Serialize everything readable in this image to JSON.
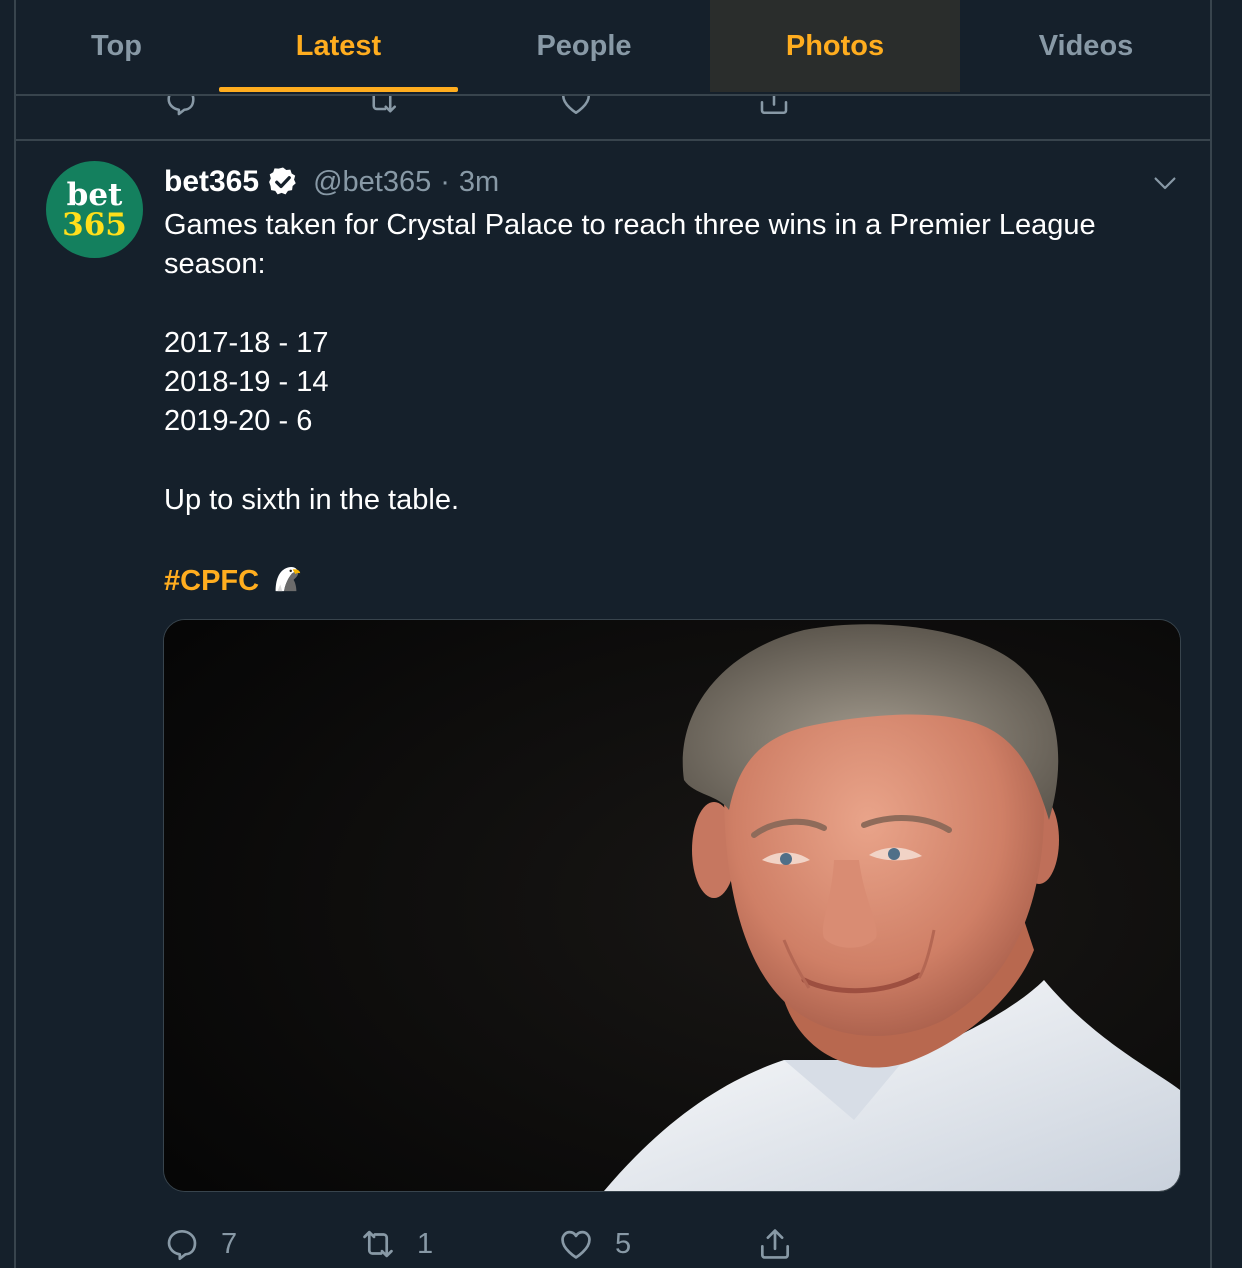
{
  "tabs": [
    {
      "label": "Top"
    },
    {
      "label": "Latest"
    },
    {
      "label": "People"
    },
    {
      "label": "Photos"
    },
    {
      "label": "Videos"
    }
  ],
  "active_tab": "Latest",
  "hovered_tab": "Photos",
  "colors": {
    "background": "#15202b",
    "accent": "#ffad1f",
    "secondary_text": "#8899a6",
    "border": "#38444d",
    "avatar_bg": "#14805e",
    "avatar_yellow": "#ffdf1b"
  },
  "tweet": {
    "avatar": {
      "line1": "bet",
      "line2": "365"
    },
    "display_name": "bet365",
    "verified_icon": "verified-badge-icon",
    "handle": "@bet365",
    "separator": "·",
    "time": "3m",
    "text_lines": [
      "Games taken for Crystal Palace to reach three wins in a Premier League",
      "season:",
      "",
      "2017-18 - 17",
      "2018-19 - 14",
      "2019-20 - 6",
      "",
      "Up to sixth in the table.",
      ""
    ],
    "hashtag": "#CPFC",
    "emoji": "eagle-emoji",
    "photo": "portrait photo of an older man in a white shirt against a dark background",
    "actions": {
      "reply": {
        "icon": "reply-icon",
        "count": "7"
      },
      "retweet": {
        "icon": "retweet-icon",
        "count": "1"
      },
      "like": {
        "icon": "heart-icon",
        "count": "5"
      },
      "share": {
        "icon": "share-icon"
      }
    }
  }
}
